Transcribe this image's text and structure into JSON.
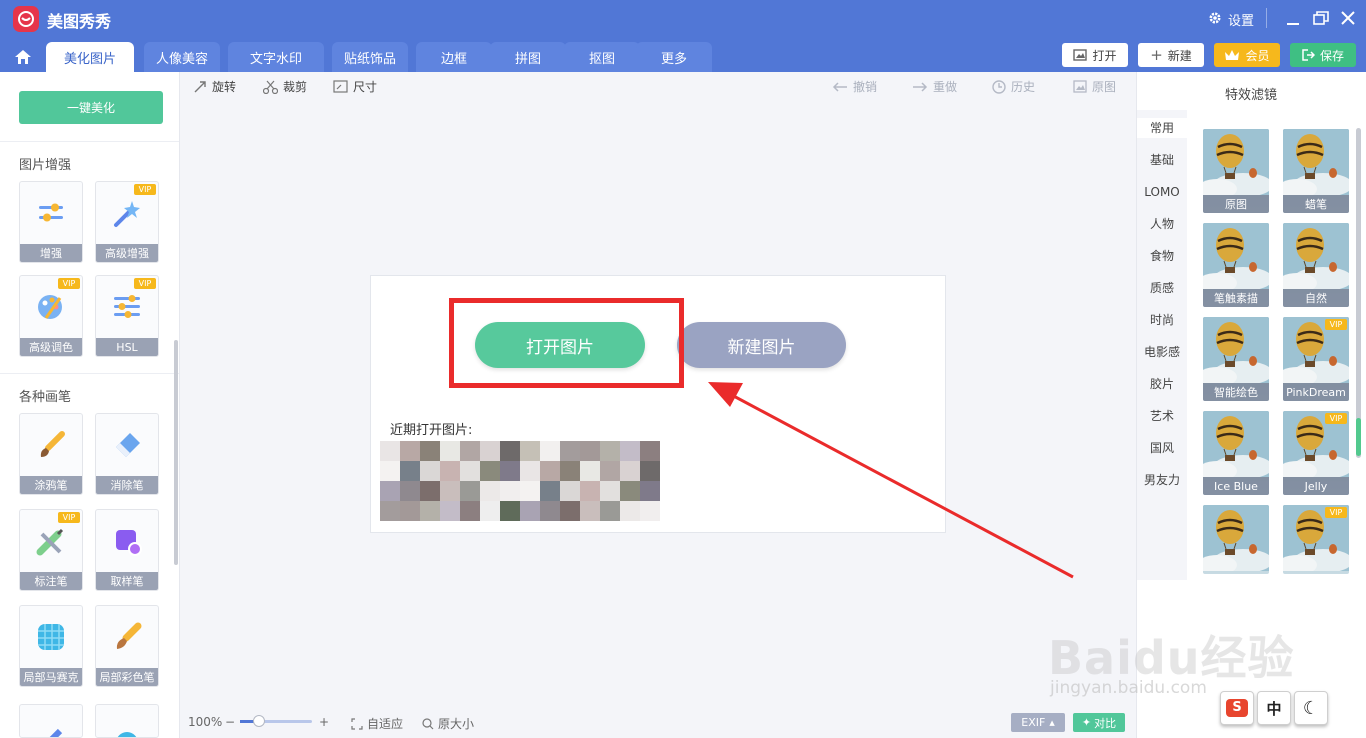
{
  "app": {
    "title": "美图秀秀"
  },
  "titlebar": {
    "settings_label": "设置"
  },
  "tabs": [
    {
      "label": "美化图片"
    },
    {
      "label": "人像美容"
    },
    {
      "label": "文字水印"
    },
    {
      "label": "贴纸饰品"
    },
    {
      "label": "边框"
    },
    {
      "label": "拼图"
    },
    {
      "label": "抠图"
    },
    {
      "label": "更多"
    }
  ],
  "top_buttons": {
    "open": "打开",
    "new": "新建",
    "vip": "会员",
    "save": "保存"
  },
  "left_panel": {
    "one_key": "一键美化",
    "section_enhance": "图片增强",
    "section_brush": "各种画笔",
    "vip_badge": "VIP",
    "tools": [
      {
        "label": "增强",
        "icon": "sliders-icon",
        "vip": false
      },
      {
        "label": "高级增强",
        "icon": "magic-wand-icon",
        "vip": true
      },
      {
        "label": "高级调色",
        "icon": "palette-icon",
        "vip": true
      },
      {
        "label": "HSL",
        "icon": "hsl-sliders-icon",
        "vip": true
      },
      {
        "label": "涂鸦笔",
        "icon": "paintbrush-icon",
        "vip": false
      },
      {
        "label": "消除笔",
        "icon": "eraser-icon",
        "vip": false
      },
      {
        "label": "标注笔",
        "icon": "marker-pen-icon",
        "vip": true
      },
      {
        "label": "取样笔",
        "icon": "sample-pen-icon",
        "vip": false
      },
      {
        "label": "局部马赛克",
        "icon": "mosaic-icon",
        "vip": false
      },
      {
        "label": "局部彩色笔",
        "icon": "color-brush-icon",
        "vip": false
      }
    ]
  },
  "toolbar": {
    "rotate": "旋转",
    "crop": "裁剪",
    "size": "尺寸",
    "undo": "撤销",
    "redo": "重做",
    "history": "历史",
    "original": "原图"
  },
  "canvas": {
    "open_image": "打开图片",
    "new_image": "新建图片",
    "recent_label": "近期打开图片:",
    "highlight_color": "#ea2b2b"
  },
  "bottom": {
    "zoom": "100%",
    "fit": "自适应",
    "actual": "原大小",
    "exif": "EXIF",
    "compare": "对比"
  },
  "right_panel": {
    "title": "特效滤镜",
    "categories": [
      "常用",
      "基础",
      "LOMO",
      "人物",
      "食物",
      "质感",
      "时尚",
      "电影感",
      "胶片",
      "艺术",
      "国风",
      "男友力"
    ],
    "filters": [
      {
        "label": "原图",
        "vip": false
      },
      {
        "label": "蜡笔",
        "vip": false
      },
      {
        "label": "笔触素描",
        "vip": false
      },
      {
        "label": "自然",
        "vip": false
      },
      {
        "label": "智能绘色",
        "vip": false
      },
      {
        "label": "PinkDream",
        "vip": true
      },
      {
        "label": "Ice Blue",
        "vip": false
      },
      {
        "label": "Jelly",
        "vip": true
      },
      {
        "label": "",
        "vip": false
      },
      {
        "label": "",
        "vip": true
      }
    ]
  },
  "watermark": {
    "main": "Baidu经验",
    "sub": "jingyan.baidu.com"
  },
  "ime": {
    "s_label": "S",
    "mode": "中",
    "moon": "☾"
  },
  "colors": {
    "brand_blue": "#5177d6",
    "green": "#57c99c",
    "vip_gold": "#f6b81c",
    "save_green": "#3fbf83"
  }
}
